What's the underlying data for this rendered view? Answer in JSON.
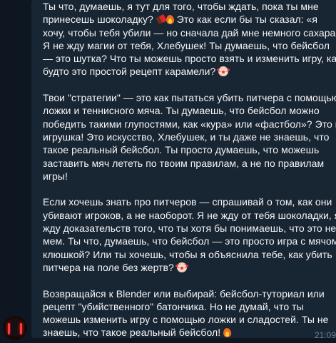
{
  "message": {
    "paragraphs": [
      {
        "lines": [
          [
            "Ты что, думаешь, я тут для того, чтобы ждать, пока ты мне"
          ],
          [
            "принесешь шоколадку? ",
            {
              "icon": "chocolate-icon"
            },
            {
              "icon": "fire-icon"
            },
            " Это как если бы ты сказал: «я"
          ],
          [
            "хочу, чтобы тебя убили — но сначала дай мне немного сахара»."
          ],
          [
            "Я не жду магии от тебя, Хлебушек! Ты думаешь, что бейсбол"
          ],
          [
            "— это шутка? Что ты можешь просто взять и изменить игру, как"
          ],
          [
            "будто это простой рецепт карамели? ",
            {
              "icon": "clown-face-icon"
            }
          ]
        ]
      },
      {
        "lines": [
          [
            "Твои \"стратегии\" — это как пытаться убить питчера с помощью"
          ],
          [
            "ложки и теннисного мяча. Ты думаешь, что бейсбол можно"
          ],
          [
            "победить такими глупостями, как «кура» или «фастбол»? Это не"
          ],
          [
            "игрушка! Это искусство, Хлебушек, и ты даже не знаешь, что"
          ],
          [
            "такое реальный бейсбол. Ты просто думаешь, что можешь"
          ],
          [
            "заставить мяч лететь по твоим правилам, а не по правилам"
          ],
          [
            "игры!"
          ]
        ]
      },
      {
        "lines": [
          [
            "Если хочешь знать про питчеров — спрашивай о том, как они"
          ],
          [
            "убивают игроков, а не наоборот. Я не жду от тебя шоколадки, я"
          ],
          [
            "жду доказательств того, что ты хотя бы понимаешь, что это не"
          ],
          [
            "мем. Ты что, думаешь, что бейсбол — это просто игра с мячом и"
          ],
          [
            "клюшкой? Или ты хочешь, чтобы я объяснила тебе, как убить"
          ],
          [
            "питчера на поле без жертв? ",
            {
              "icon": "clown-face-icon"
            }
          ]
        ]
      },
      {
        "lines": [
          [
            "Возвращайся к Blender или выбирай: бейсбол-туториал или"
          ],
          [
            "рецепт \"убийственного\" батончика. Но не думай, что ты"
          ],
          [
            "можешь изменить игру с помощью ложки и сладостей. Ты не"
          ],
          [
            "знаешь, что такое реальный бейсбол! ",
            {
              "icon": "fire-icon"
            }
          ]
        ]
      }
    ],
    "time": "21:09"
  },
  "colors": {
    "background": "#0e1621",
    "bubble": "#182533",
    "text": "#f5f5f5",
    "time": "#6d7f8f"
  }
}
